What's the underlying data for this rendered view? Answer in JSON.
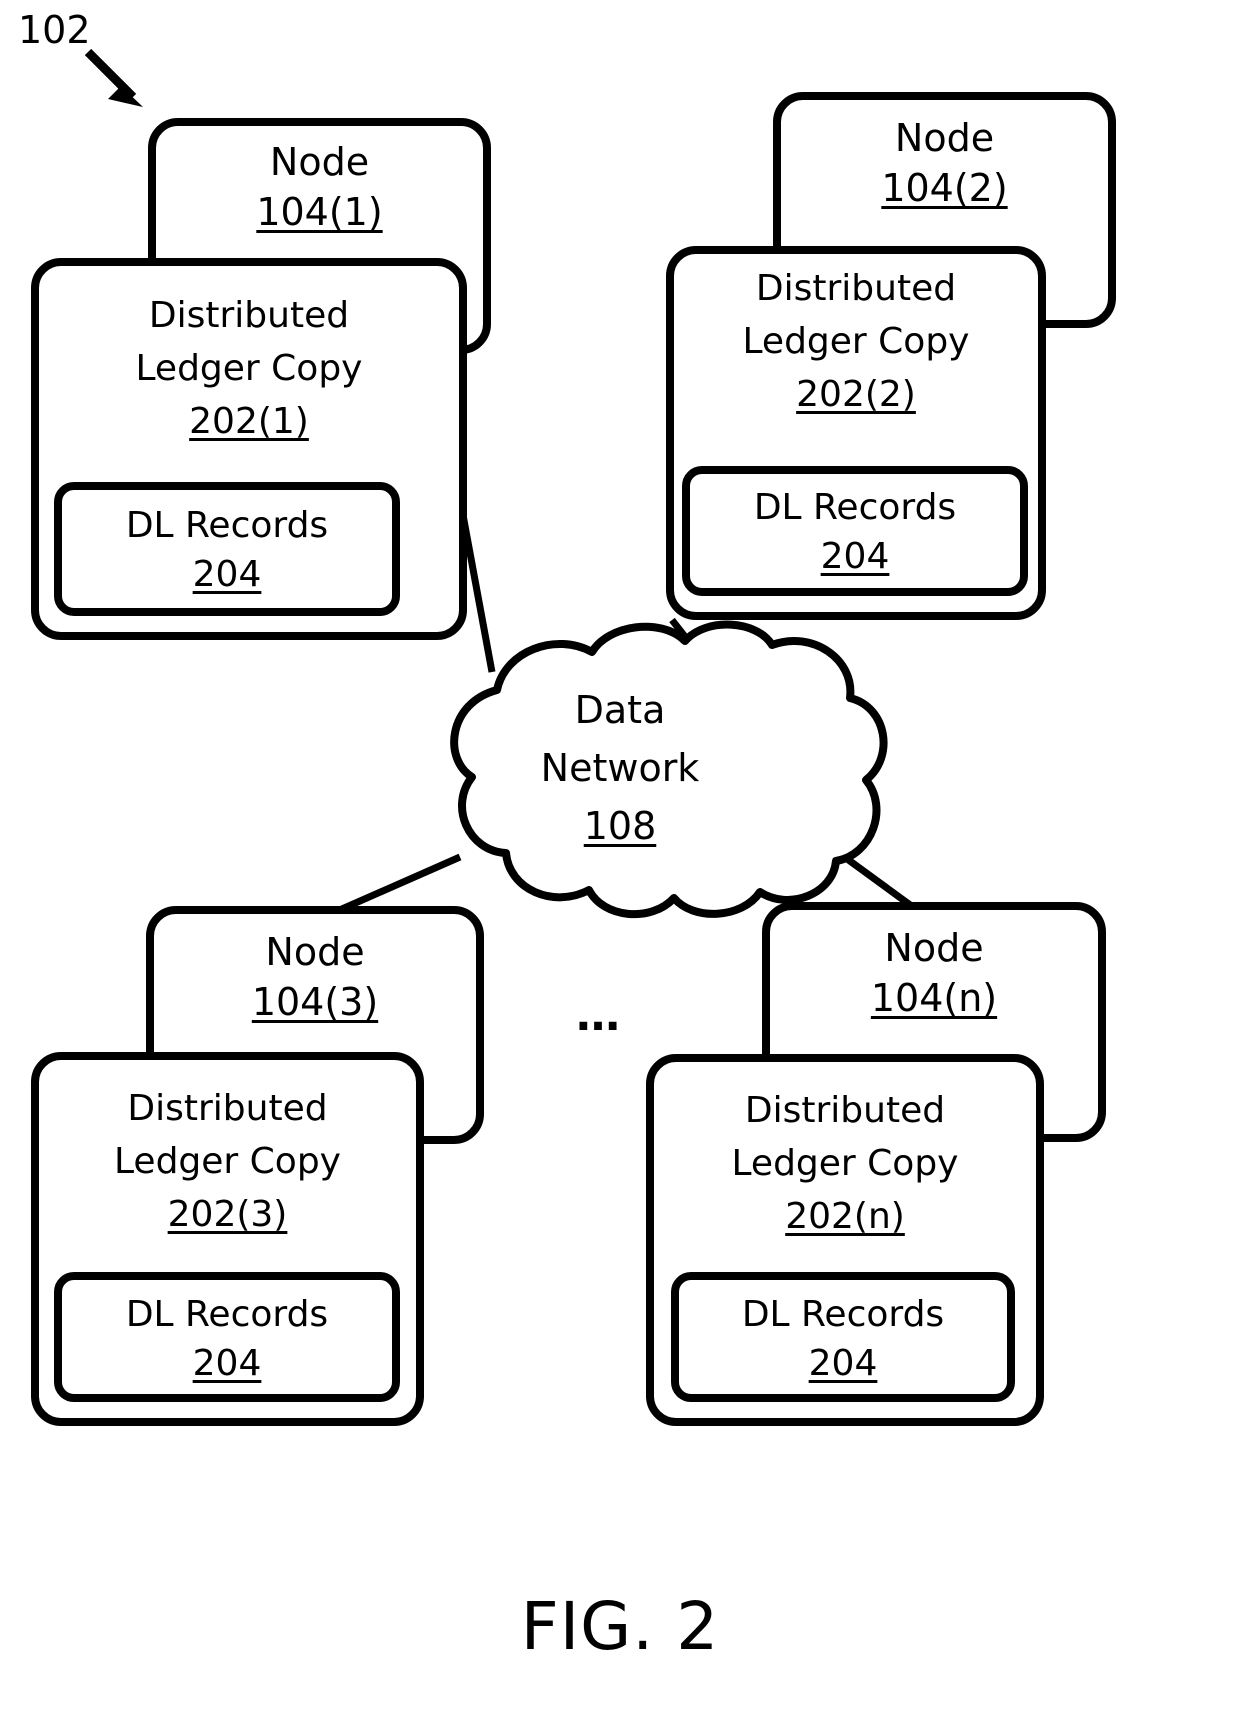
{
  "figure": {
    "caption": "FIG. 2",
    "system_label": "102",
    "ellipsis": "…"
  },
  "network": {
    "name": "Data Network",
    "line1": "Data",
    "line2": "Network",
    "ref": "108",
    "icon": "cloud-icon"
  },
  "nodes": [
    {
      "id": "node-1",
      "title": "Node",
      "ref": "104(1)",
      "ledger": {
        "line1": "Distributed",
        "line2": "Ledger Copy",
        "ref": "202(1)",
        "records": {
          "title": "DL Records",
          "ref": "204"
        }
      }
    },
    {
      "id": "node-2",
      "title": "Node",
      "ref": "104(2)",
      "ledger": {
        "line1": "Distributed",
        "line2": "Ledger Copy",
        "ref": "202(2)",
        "records": {
          "title": "DL Records",
          "ref": "204"
        }
      }
    },
    {
      "id": "node-3",
      "title": "Node",
      "ref": "104(3)",
      "ledger": {
        "line1": "Distributed",
        "line2": "Ledger Copy",
        "ref": "202(3)",
        "records": {
          "title": "DL Records",
          "ref": "204"
        }
      }
    },
    {
      "id": "node-n",
      "title": "Node",
      "ref": "104(n)",
      "ledger": {
        "line1": "Distributed",
        "line2": "Ledger Copy",
        "ref": "202(n)",
        "records": {
          "title": "DL Records",
          "ref": "204"
        }
      }
    }
  ],
  "style": {
    "stroke": "#000000",
    "background": "#ffffff"
  }
}
